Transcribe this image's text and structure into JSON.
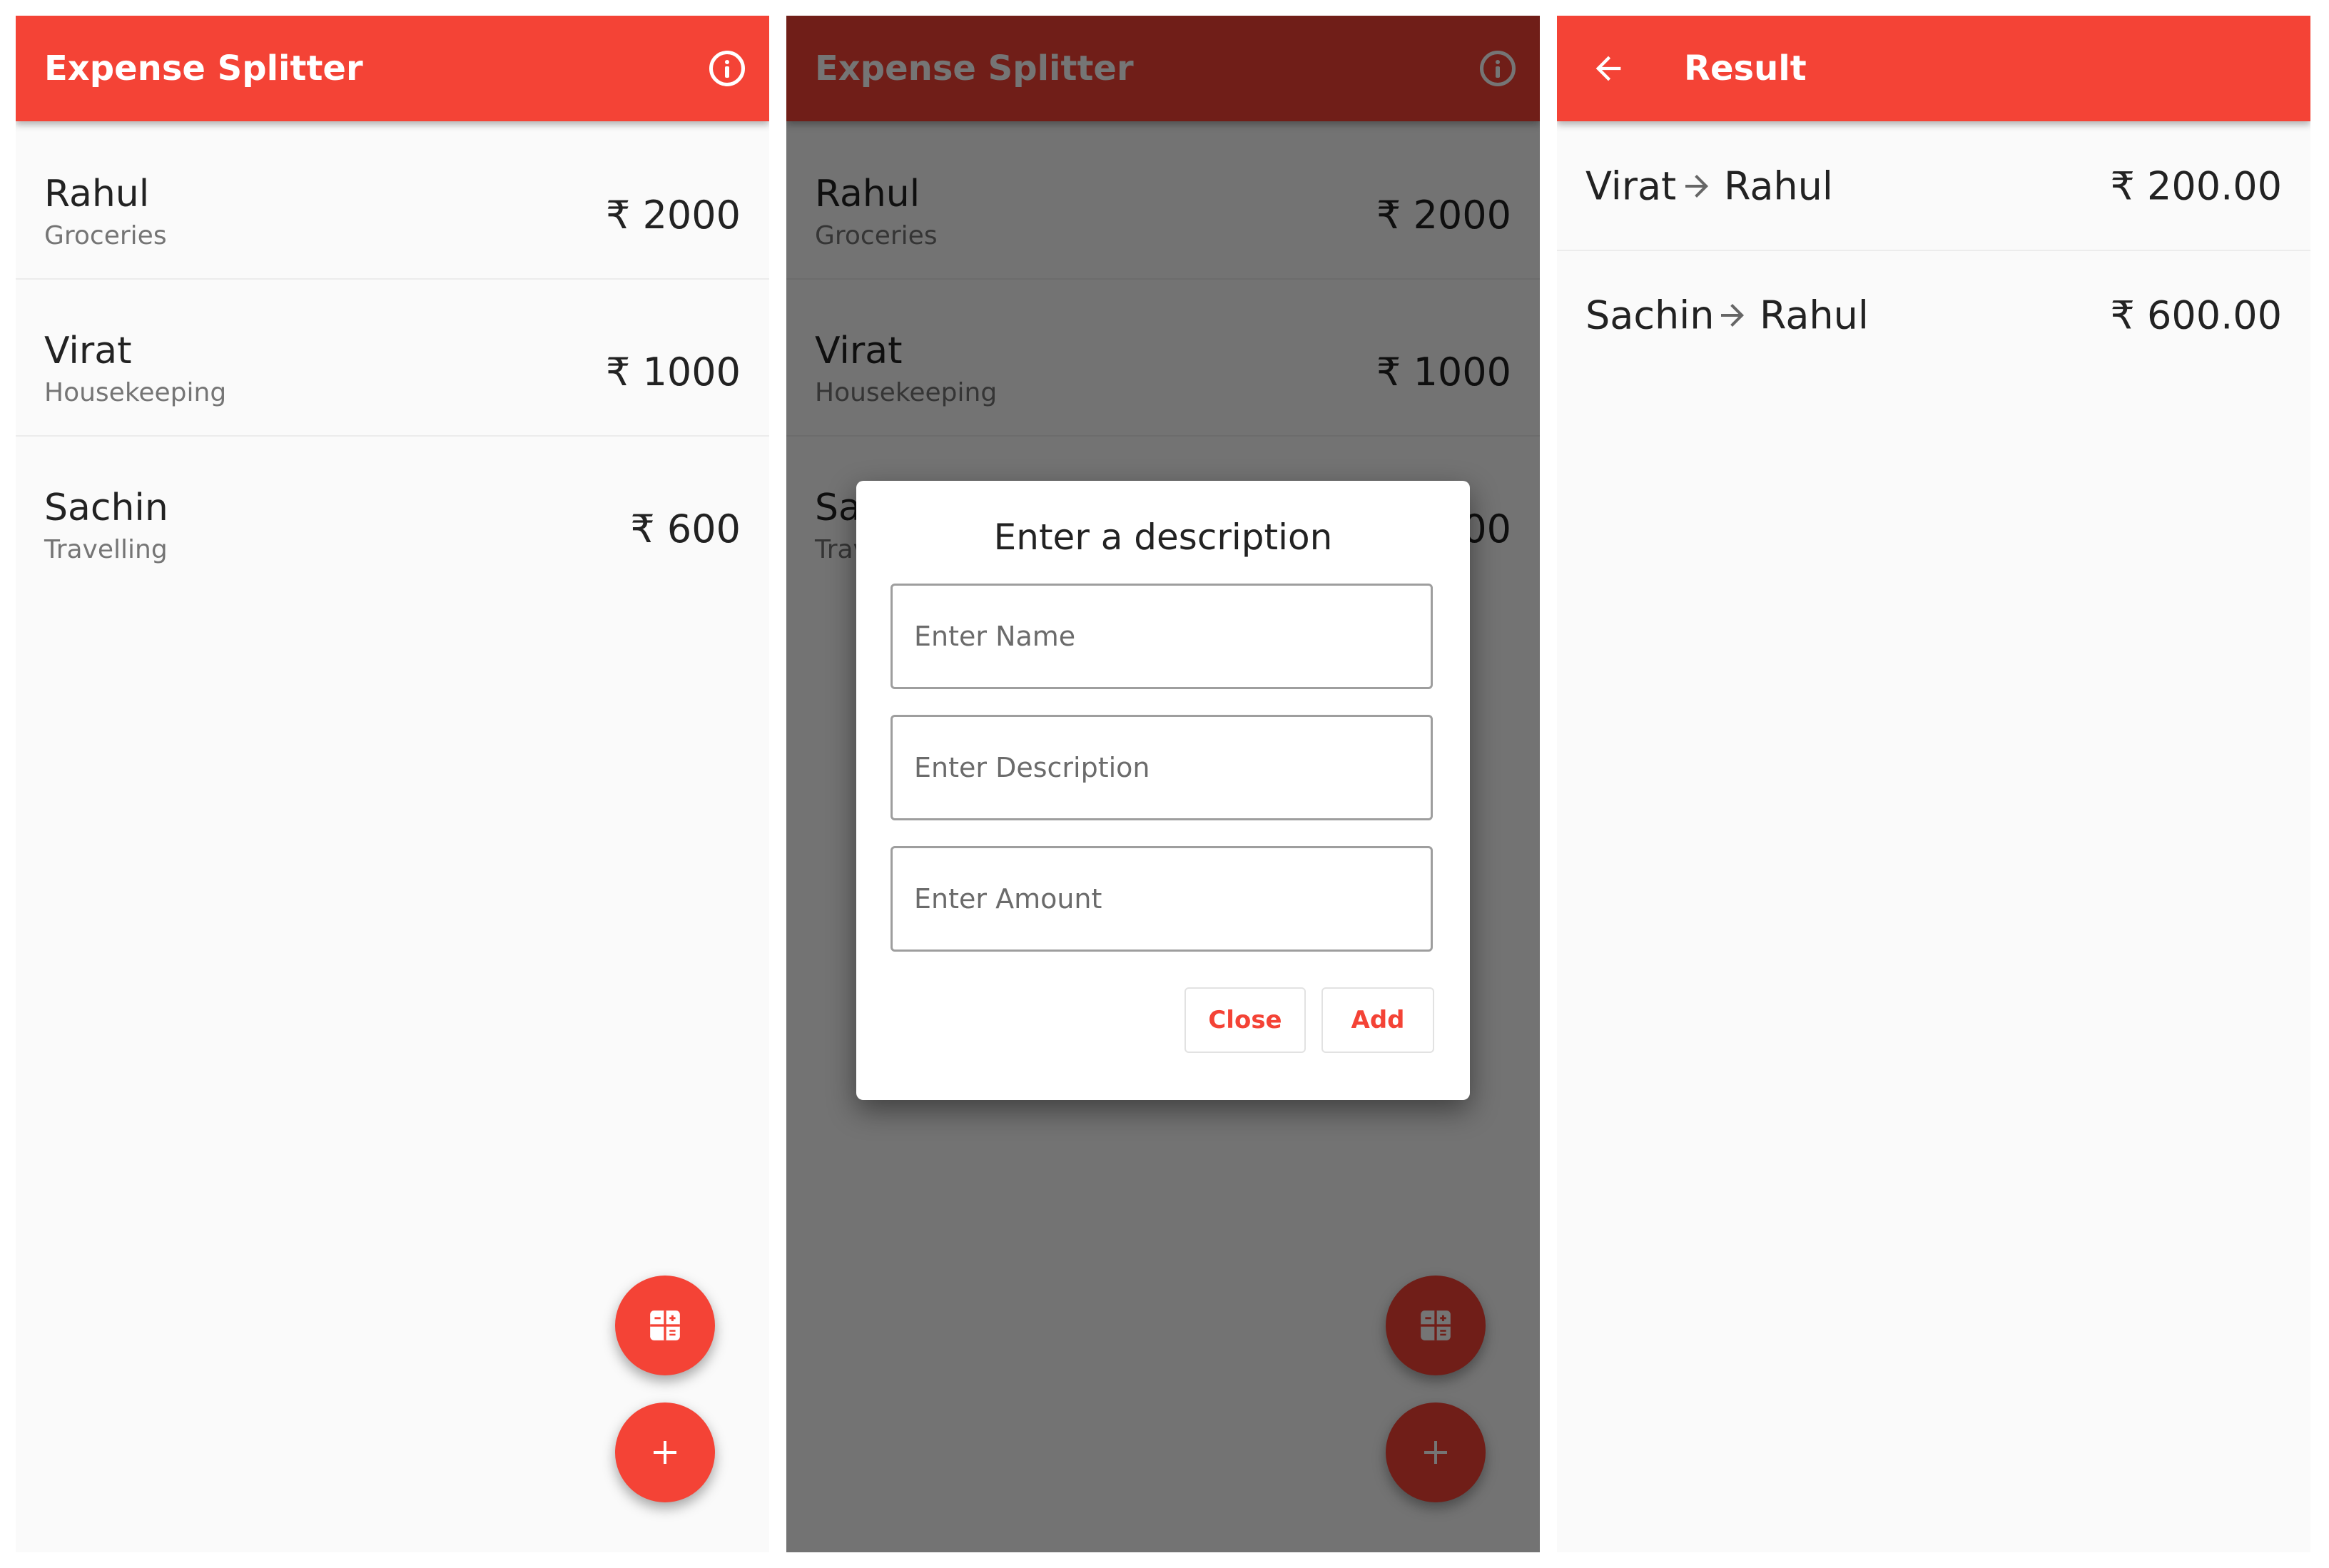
{
  "main": {
    "title": "Expense Splitter",
    "icons": {
      "info": "info-icon",
      "calculate": "calculator-icon",
      "add": "plus-icon"
    },
    "expenses": [
      {
        "name": "Rahul",
        "description": "Groceries",
        "amount": "₹ 2000"
      },
      {
        "name": "Virat",
        "description": "Housekeeping",
        "amount": "₹ 1000"
      },
      {
        "name": "Sachin",
        "description": "Travelling",
        "amount": "₹ 600"
      }
    ]
  },
  "dialog": {
    "title": "Enter a description",
    "name_placeholder": "Enter Name",
    "description_placeholder": "Enter Description",
    "amount_placeholder": "Enter Amount",
    "close_label": "Close",
    "add_label": "Add"
  },
  "result": {
    "title": "Result",
    "icons": {
      "back": "arrow-back-icon",
      "arrow": "arrow-right-icon"
    },
    "settlements": [
      {
        "from": "Virat",
        "to": "Rahul",
        "amount": "₹ 200.00"
      },
      {
        "from": "Sachin",
        "to": "Rahul",
        "amount": "₹ 600.00"
      }
    ]
  },
  "colors": {
    "primary": "#f44336",
    "background": "#fafafa",
    "scrim": "rgba(0,0,0,0.54)",
    "secondary_text": "#757575"
  }
}
